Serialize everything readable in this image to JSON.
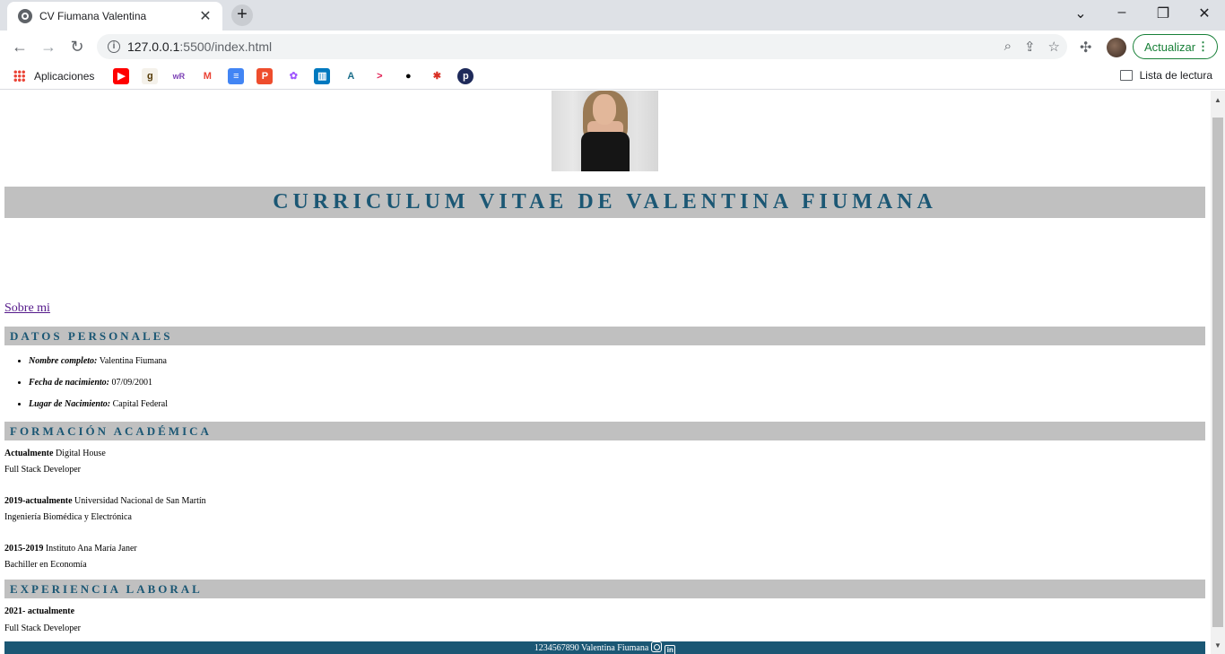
{
  "browser": {
    "tab_title": "CV Fiumana Valentina",
    "tab_close": "✕",
    "new_tab": "+",
    "url_host": "127.0.0.1",
    "url_path": ":5500/index.html",
    "update_label": "Actualizar",
    "reading_list": "Lista de lectura",
    "apps_label": "Aplicaciones",
    "bookmark_icons": [
      "youtube-icon",
      "goodreads-icon",
      "wordreference-icon",
      "gmail-icon",
      "google-docs-icon",
      "pinterest-like-icon",
      "figma-icon",
      "trello-icon",
      "bookmark-a-icon",
      "arrow-bookmark-icon",
      "github-icon",
      "anatomy-icon",
      "p-bookmark-icon"
    ]
  },
  "page": {
    "title": "CURRICULUM VITAE DE VALENTINA FIUMANA",
    "about_link": "Sobre mi",
    "personal": {
      "heading": "DATOS PERSONALES",
      "items": [
        {
          "label": "Nombre completo:",
          "value": "Valentina Fiumana"
        },
        {
          "label": "Fecha de nacimiento:",
          "value": "07/09/2001"
        },
        {
          "label": "Lugar de Nacimiento:",
          "value": "Capital Federal"
        }
      ]
    },
    "education": {
      "heading": "FORMACIÓN ACADÉMICA",
      "entries": [
        {
          "period": "Actualmente",
          "institution": "Digital House",
          "degree": "Full Stack Developer"
        },
        {
          "period": "2019-actualmente",
          "institution": "Universidad Nacional de San Martín",
          "degree": "Ingeniería Biomédica y Electrónica"
        },
        {
          "period": "2015-2019",
          "institution": "Instituto Ana María Janer",
          "degree": "Bachiller en Economía"
        }
      ]
    },
    "experience": {
      "heading": "EXPERIENCIA LABORAL",
      "entries": [
        {
          "period": "2021- actualmente",
          "role": "Full Stack Developer"
        }
      ]
    },
    "footer": {
      "text": "1234567890 Valentina Fiumana",
      "linkedin": "in"
    }
  }
}
